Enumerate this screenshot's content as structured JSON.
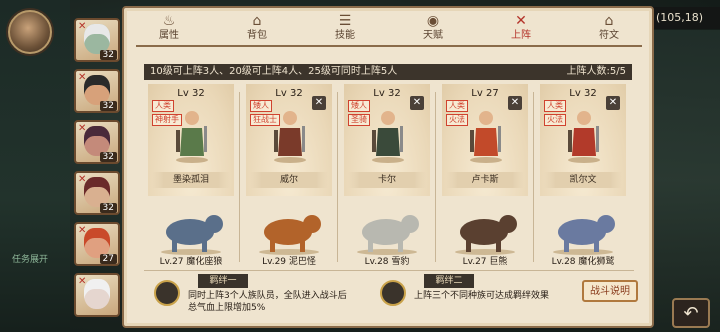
{
  "hud": {
    "coordinates": "(105,18)",
    "left_label": "任务展开"
  },
  "heroes": [
    {
      "level": "32",
      "tone": "#9bb7a0",
      "hair": "#e8e8e8"
    },
    {
      "level": "32",
      "tone": "#d7a17a",
      "hair": "#2a2a2a"
    },
    {
      "level": "32",
      "tone": "#c48a7a",
      "hair": "#4a2a3a"
    },
    {
      "level": "32",
      "tone": "#d9b090",
      "hair": "#6a2a2a"
    },
    {
      "level": "27",
      "tone": "#e0a080",
      "hair": "#c94a2a"
    },
    {
      "level": "",
      "tone": "#e5d6cf",
      "hair": "#f0f0f0"
    }
  ],
  "tabs": [
    {
      "label": "属性",
      "icon": "flame-icon",
      "glyph": "♨"
    },
    {
      "label": "背包",
      "icon": "bag-icon",
      "glyph": "⌂"
    },
    {
      "label": "技能",
      "icon": "book-icon",
      "glyph": "☰"
    },
    {
      "label": "天赋",
      "icon": "eye-icon",
      "glyph": "◉"
    },
    {
      "label": "上阵",
      "icon": "swords-icon",
      "glyph": "✕"
    },
    {
      "label": "符文",
      "icon": "shrine-icon",
      "glyph": "⌂"
    }
  ],
  "info": {
    "text": "10级可上阵3人、20级可上阵4人、25级可同时上阵5人",
    "count": "上阵人数:5/5"
  },
  "slots": [
    {
      "level": "Lv 32",
      "tags": [
        "人类",
        "神射手"
      ],
      "name": "墨染孤泪",
      "closable": false,
      "beast": "Lv.27 魔化座狼",
      "color": "#5a7a4a",
      "beast_color": "#5a6f8a"
    },
    {
      "level": "Lv 32",
      "tags": [
        "矮人",
        "狂战士"
      ],
      "name": "威尔",
      "closable": true,
      "beast": "Lv.29 泥巴怪",
      "color": "#7a3a2a",
      "beast_color": "#b2632a"
    },
    {
      "level": "Lv 32",
      "tags": [
        "矮人",
        "圣骑"
      ],
      "name": "卡尔",
      "closable": true,
      "beast": "Lv.28 雪豹",
      "color": "#3a4a3a",
      "beast_color": "#b8b8b0"
    },
    {
      "level": "Lv 27",
      "tags": [
        "人类",
        "火法"
      ],
      "name": "卢卡斯",
      "closable": true,
      "beast": "Lv.27 巨熊",
      "color": "#c24a2a",
      "beast_color": "#5a4030"
    },
    {
      "level": "Lv 32",
      "tags": [
        "人类",
        "火法"
      ],
      "name": "凯尔文",
      "closable": true,
      "beast": "Lv.28 魔化狮鹫",
      "color": "#b23a2a",
      "beast_color": "#6a7aa0"
    }
  ],
  "bonds": [
    {
      "title": "羁绊一",
      "line1": "同时上阵3个人族队员，全队进入战斗后",
      "line2": "总气血上限增加5%"
    },
    {
      "title": "羁绊二",
      "line1": "上阵三个不同种族可达成羁绊效果",
      "line2": ""
    }
  ],
  "buttons": {
    "explain": "战斗说明"
  }
}
